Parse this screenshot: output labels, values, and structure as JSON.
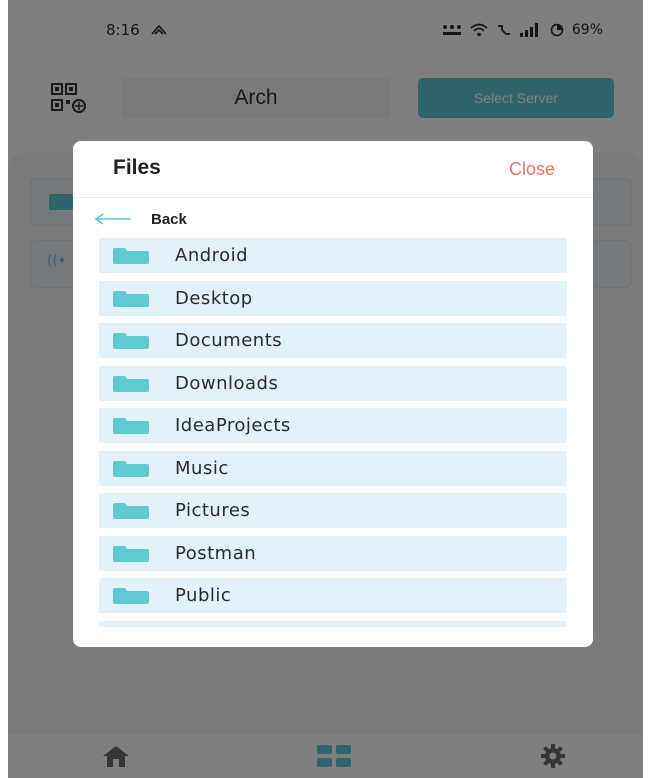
{
  "status_bar": {
    "time": "8:16",
    "indicators": "°°°",
    "battery": "69%"
  },
  "top_bar": {
    "server_name": "Arch",
    "select_server_label": "Select Server"
  },
  "files_dialog": {
    "title": "Files",
    "close_label": "Close",
    "back_label": "Back",
    "items": [
      {
        "label": "Android"
      },
      {
        "label": "Desktop"
      },
      {
        "label": "Documents"
      },
      {
        "label": "Downloads"
      },
      {
        "label": "IdeaProjects"
      },
      {
        "label": "Music"
      },
      {
        "label": "Pictures"
      },
      {
        "label": "Postman"
      },
      {
        "label": "Public"
      }
    ]
  },
  "bottom_nav": {
    "items": [
      {
        "icon": "home-icon"
      },
      {
        "icon": "grid-icon"
      },
      {
        "icon": "gear-icon"
      }
    ]
  },
  "colors": {
    "accent": "#5fc9d6",
    "close": "#e8736a",
    "row_bg": "#e3f1fb",
    "folder": "#5fc9d6"
  }
}
